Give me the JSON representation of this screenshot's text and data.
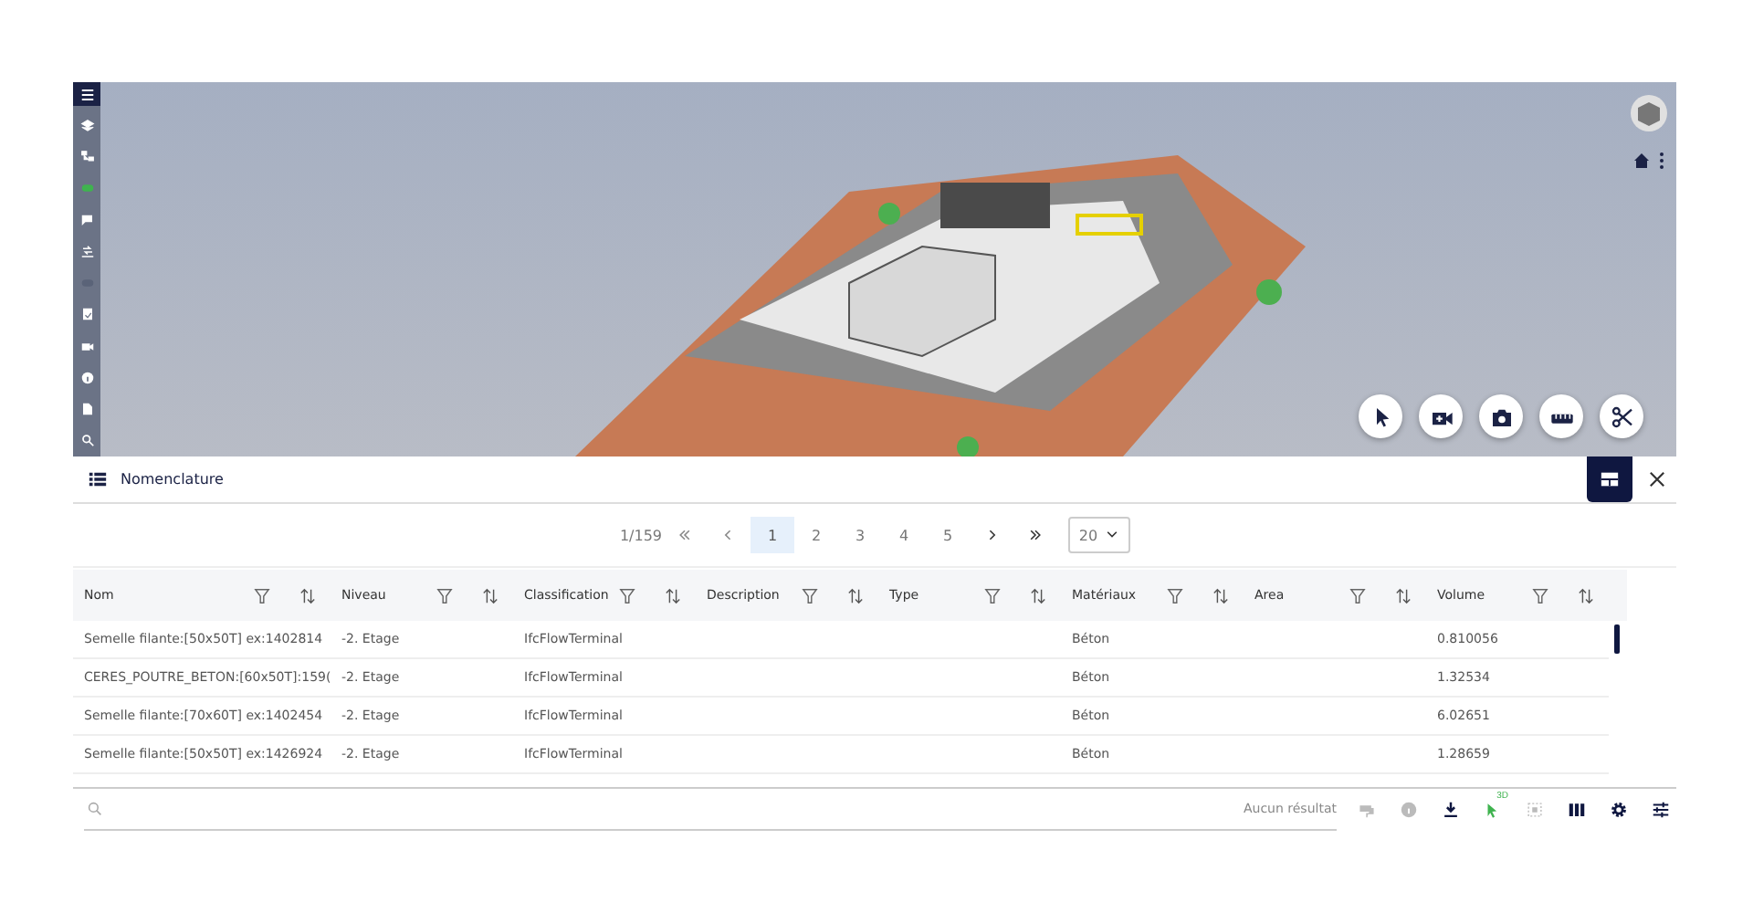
{
  "side_tools": [
    {
      "kind": "menu",
      "selected": true
    },
    {
      "kind": "layers",
      "selected": false
    },
    {
      "kind": "tree",
      "selected": false
    },
    {
      "kind": "dot",
      "selected": false,
      "color": "#3fb34f"
    },
    {
      "kind": "comments",
      "selected": false
    },
    {
      "kind": "compare",
      "selected": false
    },
    {
      "kind": "tag",
      "selected": false
    },
    {
      "kind": "clipboard",
      "selected": false
    },
    {
      "kind": "camera",
      "selected": false
    },
    {
      "kind": "info",
      "selected": false
    },
    {
      "kind": "document",
      "selected": false
    },
    {
      "kind": "search",
      "selected": false
    }
  ],
  "viewer_tools": [
    {
      "kind": "pointer"
    },
    {
      "kind": "video"
    },
    {
      "kind": "photo"
    },
    {
      "kind": "ruler"
    },
    {
      "kind": "scissors"
    }
  ],
  "panel": {
    "title": "Nomenclature",
    "layout_selected": true
  },
  "pagination": {
    "position": "1/159",
    "pages": [
      {
        "label": "1",
        "selected": true
      },
      {
        "label": "2",
        "selected": false
      },
      {
        "label": "3",
        "selected": false
      },
      {
        "label": "4",
        "selected": false
      },
      {
        "label": "5",
        "selected": false
      }
    ],
    "page_size": "20"
  },
  "table": {
    "columns": [
      "Nom",
      "Niveau",
      "Classification",
      "Description",
      "Type",
      "Matériaux",
      "Area",
      "Volume"
    ],
    "rows": [
      [
        "Semelle filante:[50x50T] ex:1402814",
        "-2. Etage",
        "IfcFlowTerminal",
        "",
        "",
        "Béton",
        "",
        "0.810056"
      ],
      [
        "CERES_POUTRE_BETON:[60x50T]:159(",
        "-2. Etage",
        "IfcFlowTerminal",
        "",
        "",
        "Béton",
        "",
        "1.32534"
      ],
      [
        "Semelle filante:[70x60T] ex:1402454",
        "-2. Etage",
        "IfcFlowTerminal",
        "",
        "",
        "Béton",
        "",
        "6.02651"
      ],
      [
        "Semelle filante:[50x50T] ex:1426924",
        "-2. Etage",
        "IfcFlowTerminal",
        "",
        "",
        "Béton",
        "",
        "1.28659"
      ]
    ]
  },
  "footer": {
    "result": "Aucun résultat",
    "tools": [
      {
        "kind": "paint",
        "disabled": true
      },
      {
        "kind": "info",
        "disabled": true
      },
      {
        "kind": "download",
        "disabled": false
      },
      {
        "kind": "pointer3d",
        "disabled": false,
        "label": "3D"
      },
      {
        "kind": "frame",
        "disabled": true
      },
      {
        "kind": "columns",
        "disabled": false
      },
      {
        "kind": "settings",
        "disabled": false
      },
      {
        "kind": "sliders",
        "disabled": false
      }
    ]
  }
}
